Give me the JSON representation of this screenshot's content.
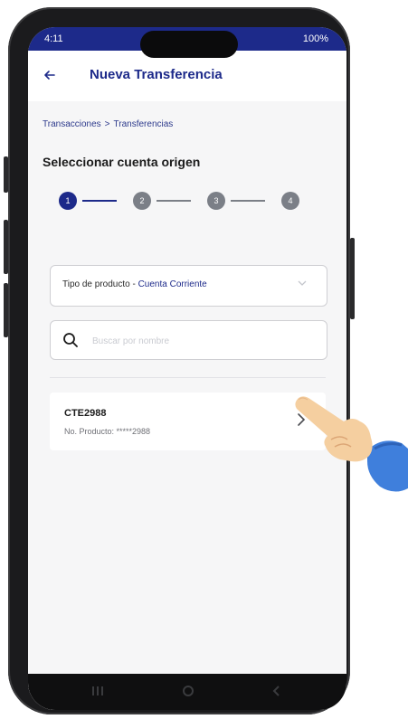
{
  "status_bar": {
    "time": "4:11",
    "right": "100%"
  },
  "app_bar": {
    "title": "Nueva Transferencia",
    "back_icon": "arrow-left-icon"
  },
  "breadcrumb": {
    "items": [
      "Transacciones",
      "Transferencias"
    ],
    "separator": ">"
  },
  "section_title": "Seleccionar cuenta origen",
  "stepper": {
    "steps": [
      "1",
      "2",
      "3",
      "4"
    ],
    "current": 1
  },
  "product_select": {
    "label": "Tipo de producto -",
    "value": "Cuenta Corriente"
  },
  "search": {
    "placeholder": "Buscar por nombre",
    "value": ""
  },
  "accounts": [
    {
      "name": "CTE2988",
      "number": "No. Producto: *****2988"
    }
  ],
  "colors": {
    "primary": "#1d2a8a",
    "inactive": "#7b7f87",
    "background": "#f6f6f7"
  }
}
